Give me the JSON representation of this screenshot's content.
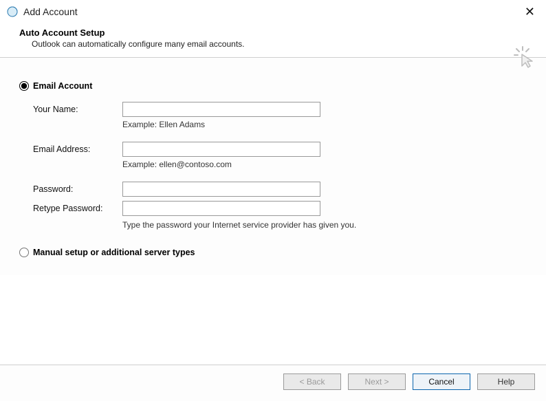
{
  "window": {
    "title": "Add Account"
  },
  "header": {
    "title": "Auto Account Setup",
    "subtitle": "Outlook can automatically configure many email accounts."
  },
  "options": {
    "email_account": "Email Account",
    "manual_setup": "Manual setup or additional server types"
  },
  "form": {
    "your_name_label": "Your Name:",
    "your_name_value": "",
    "your_name_example": "Example: Ellen Adams",
    "email_label": "Email Address:",
    "email_value": "",
    "email_example": "Example: ellen@contoso.com",
    "password_label": "Password:",
    "password_value": "",
    "retype_label": "Retype Password:",
    "retype_value": "",
    "password_hint": "Type the password your Internet service provider has given you."
  },
  "buttons": {
    "back": "< Back",
    "next": "Next >",
    "cancel": "Cancel",
    "help": "Help"
  }
}
